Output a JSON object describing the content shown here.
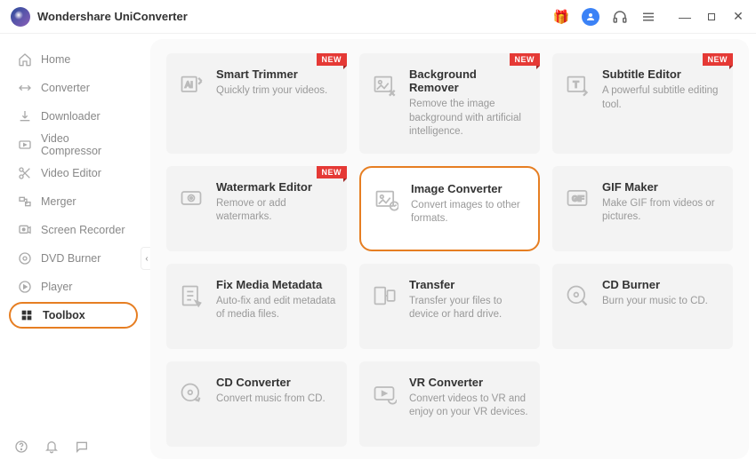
{
  "app": {
    "title": "Wondershare UniConverter"
  },
  "titlebar": {
    "gift": "🎁"
  },
  "sidebar": {
    "items": [
      {
        "label": "Home"
      },
      {
        "label": "Converter"
      },
      {
        "label": "Downloader"
      },
      {
        "label": "Video Compressor"
      },
      {
        "label": "Video Editor"
      },
      {
        "label": "Merger"
      },
      {
        "label": "Screen Recorder"
      },
      {
        "label": "DVD Burner"
      },
      {
        "label": "Player"
      },
      {
        "label": "Toolbox"
      }
    ]
  },
  "cards": [
    {
      "title": "Smart Trimmer",
      "desc": "Quickly trim your videos.",
      "new": true
    },
    {
      "title": "Background Remover",
      "desc": "Remove the image background with artificial intelligence.",
      "new": true
    },
    {
      "title": "Subtitle Editor",
      "desc": "A powerful subtitle editing tool.",
      "new": true
    },
    {
      "title": "Watermark Editor",
      "desc": "Remove or add watermarks.",
      "new": true
    },
    {
      "title": "Image Converter",
      "desc": "Convert images to other formats.",
      "new": false
    },
    {
      "title": "GIF Maker",
      "desc": "Make GIF from videos or pictures.",
      "new": false
    },
    {
      "title": "Fix Media Metadata",
      "desc": "Auto-fix and edit metadata of media files.",
      "new": false
    },
    {
      "title": "Transfer",
      "desc": "Transfer your files to device or hard drive.",
      "new": false
    },
    {
      "title": "CD Burner",
      "desc": "Burn your music to CD.",
      "new": false
    },
    {
      "title": "CD Converter",
      "desc": "Convert music from CD.",
      "new": false
    },
    {
      "title": "VR Converter",
      "desc": "Convert videos to VR and enjoy on your VR devices.",
      "new": false
    }
  ],
  "badge_text": "NEW"
}
